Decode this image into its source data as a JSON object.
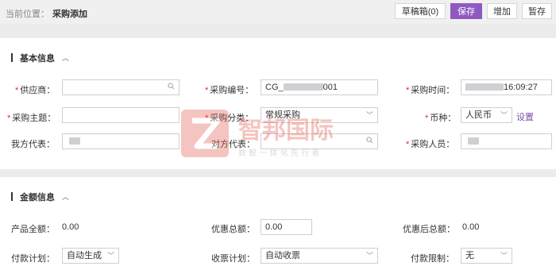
{
  "breadcrumb": {
    "prefix": "当前位置：",
    "current": "采购添加"
  },
  "toolbar": {
    "drafts": "草稿箱(0)",
    "save": "保存",
    "add": "增加",
    "pause": "暂存"
  },
  "basic": {
    "title": "基本信息",
    "supplier": {
      "label": "供应商：",
      "value": ""
    },
    "purchase_no": {
      "label": "采购编号：",
      "prefix": "CG_",
      "suffix": "001"
    },
    "purchase_time": {
      "label": "采购时间：",
      "suffix": "16:09:27"
    },
    "subject": {
      "label": "采购主题：",
      "value": ""
    },
    "category": {
      "label": "采购分类：",
      "value": "常规采购"
    },
    "currency": {
      "label": "币种：",
      "value": "人民币",
      "link": "设置"
    },
    "our_rep": {
      "label": "我方代表："
    },
    "their_rep": {
      "label": "对方代表：",
      "value": ""
    },
    "buyer": {
      "label": "采购人员："
    }
  },
  "amount": {
    "title": "金额信息",
    "product_total": {
      "label": "产品全额：",
      "value": "0.00"
    },
    "discount_total": {
      "label": "优惠总额：",
      "value": "0.00"
    },
    "after_discount": {
      "label": "优惠后总额：",
      "value": "0.00"
    },
    "payment_plan": {
      "label": "付款计划：",
      "value": "自动生成"
    },
    "invoice_plan": {
      "label": "收票计划：",
      "value": "自动收票"
    },
    "payment_limit": {
      "label": "付款限制：",
      "value": "无"
    }
  },
  "watermark": {
    "brand": "智邦国际",
    "slogan": "数 智 一 体 化 先 行 者"
  },
  "colors": {
    "accent": "#8e5ac2",
    "required": "#e5292c",
    "link": "#7a4fa8"
  }
}
